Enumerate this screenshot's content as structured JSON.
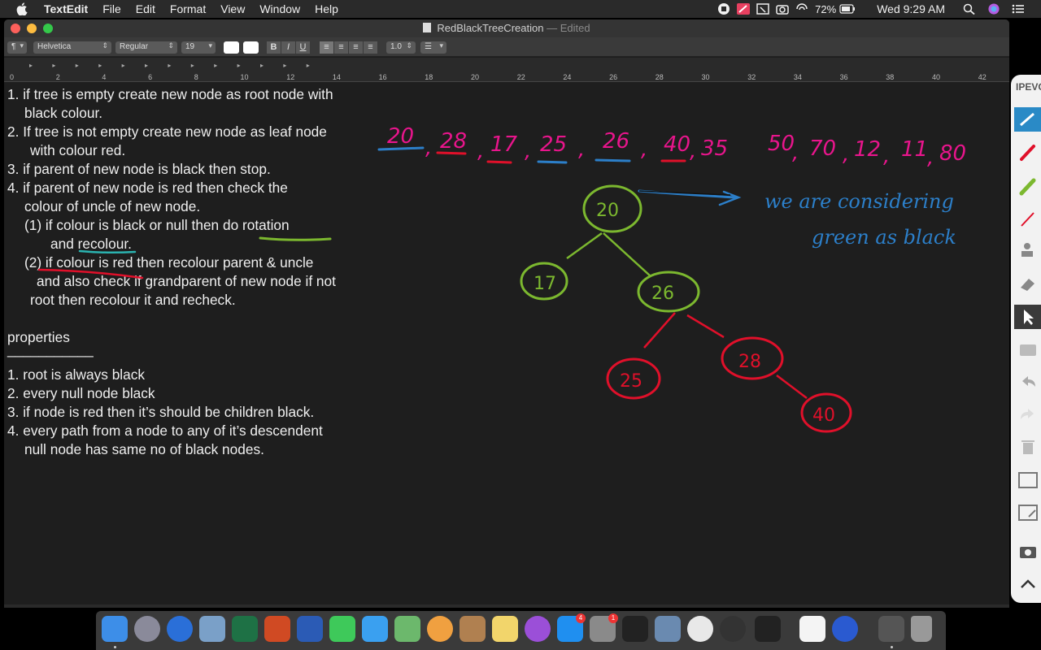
{
  "menubar": {
    "app_name": "TextEdit",
    "items": [
      "File",
      "Edit",
      "Format",
      "View",
      "Window",
      "Help"
    ],
    "battery": "72%",
    "clock": "Wed 9:29 AM"
  },
  "window": {
    "title": "RedBlackTreeCreation",
    "title_suffix": "— Edited"
  },
  "toolbar": {
    "paragraph_style": "¶",
    "font_family": "Helvetica",
    "font_style": "Regular",
    "font_size": "19",
    "bold": "B",
    "italic": "I",
    "underline": "U",
    "line_spacing": "1.0"
  },
  "ruler": {
    "numbers": [
      "0",
      "2",
      "4",
      "6",
      "8",
      "10",
      "12",
      "14",
      "16",
      "18",
      "20",
      "22",
      "24",
      "26",
      "28",
      "30",
      "32",
      "34",
      "36",
      "38",
      "40",
      "42"
    ]
  },
  "document": {
    "lines": [
      "1. if tree is empty create new node as root node with",
      "black colour.",
      "2. If tree is not empty create new node as leaf node",
      "with colour red.",
      "3. if parent of new node is black then stop.",
      "4. if parent of new node is red then check the",
      "colour of uncle of new node.",
      "(1) if colour is black or null then do rotation",
      "and recolour.",
      "(2) if colour is red then recolour parent & uncle",
      "and also check if grandparent of new node if not",
      "root then recolour it and recheck.",
      "properties",
      "___________",
      "1. root is always black",
      "2. every null node black",
      "3. if node is red then it’s should be children black.",
      "4. every path from a node to any of it’s descendent",
      "null node has same no of black nodes."
    ]
  },
  "annotations": {
    "sequence": [
      "20",
      "28",
      "17",
      "25",
      "26",
      "40",
      "35",
      "50",
      "70",
      "12",
      "11",
      "80"
    ],
    "note_line1": "we are considering",
    "note_line2": "green as black",
    "tree_nodes": [
      "20",
      "17",
      "26",
      "28",
      "25",
      "40"
    ],
    "colors": {
      "green": "#7cb82f",
      "red": "#e0102a",
      "magenta": "#e8158c",
      "blue": "#2c7fc9"
    }
  },
  "ipevo": {
    "logo": "IPEVO"
  },
  "dock": {
    "apps": [
      "Finder",
      "Launchpad",
      "Safari",
      "Preview",
      "Excel",
      "PowerPoint",
      "Word",
      "FaceTime",
      "Messages",
      "Maps",
      "Photos",
      "Contacts",
      "Notes",
      "Podcasts",
      "App Store",
      "System Preferences",
      "Apple TV",
      "Image Capture",
      "Chrome",
      "Activity",
      "Terminal",
      "TextEdit",
      "QuickTime",
      "Utilities",
      "Trash"
    ],
    "badges": {
      "App Store": "4",
      "System Preferences": "1"
    }
  }
}
